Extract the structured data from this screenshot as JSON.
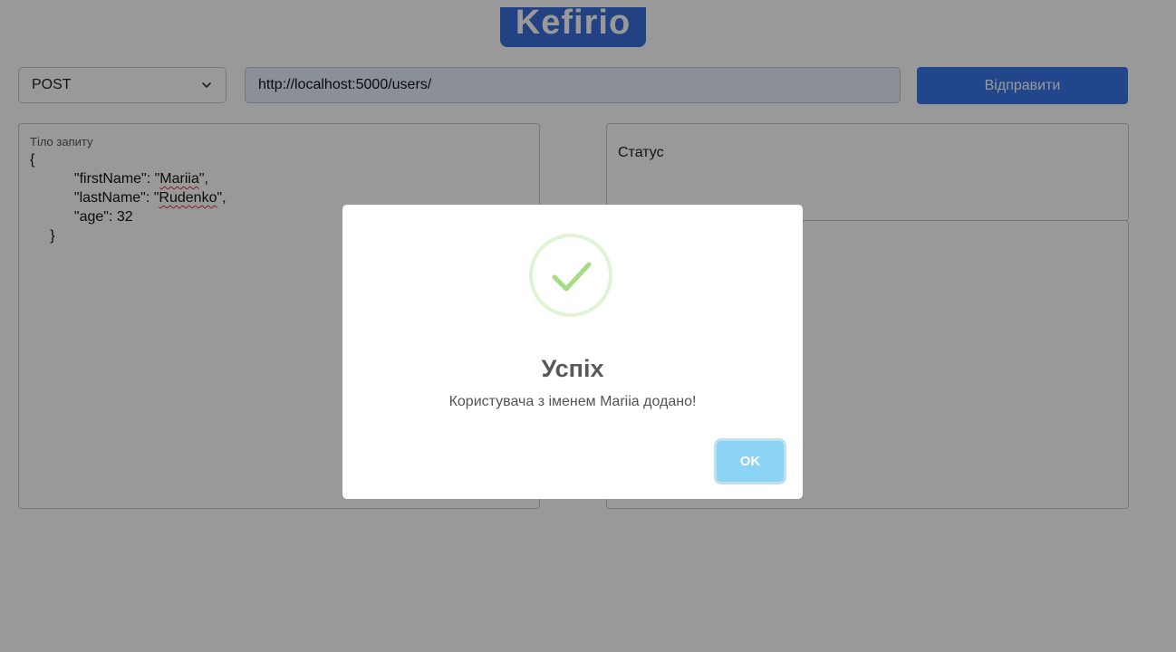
{
  "app": {
    "logo": "Kefirio"
  },
  "request": {
    "method": "POST",
    "url": "http://localhost:5000/users/",
    "send_label": "Відправити"
  },
  "body_panel": {
    "label": "Тіло запиту",
    "code": {
      "open": "{",
      "firstName_key": "\"firstName\": \"",
      "firstName_value": "Mariia",
      "firstName_end": "\",",
      "lastName_key": "\"lastName\": \"",
      "lastName_value": "Rudenko",
      "lastName_end": "\",",
      "age_line": "\"age\": 32",
      "close": "}"
    }
  },
  "status_panel": {
    "label": "Статус"
  },
  "modal": {
    "icon": "checkmark-icon",
    "title": "Успіх",
    "message": "Користувача з іменем Mariia додано!",
    "ok_label": "OK"
  },
  "colors": {
    "brand": "#3a6fdc",
    "send_button": "#3a76e8",
    "ok_button": "#8cd4f5",
    "success": "#a5dc86",
    "overlay": "rgba(0,0,0,0.4)"
  }
}
